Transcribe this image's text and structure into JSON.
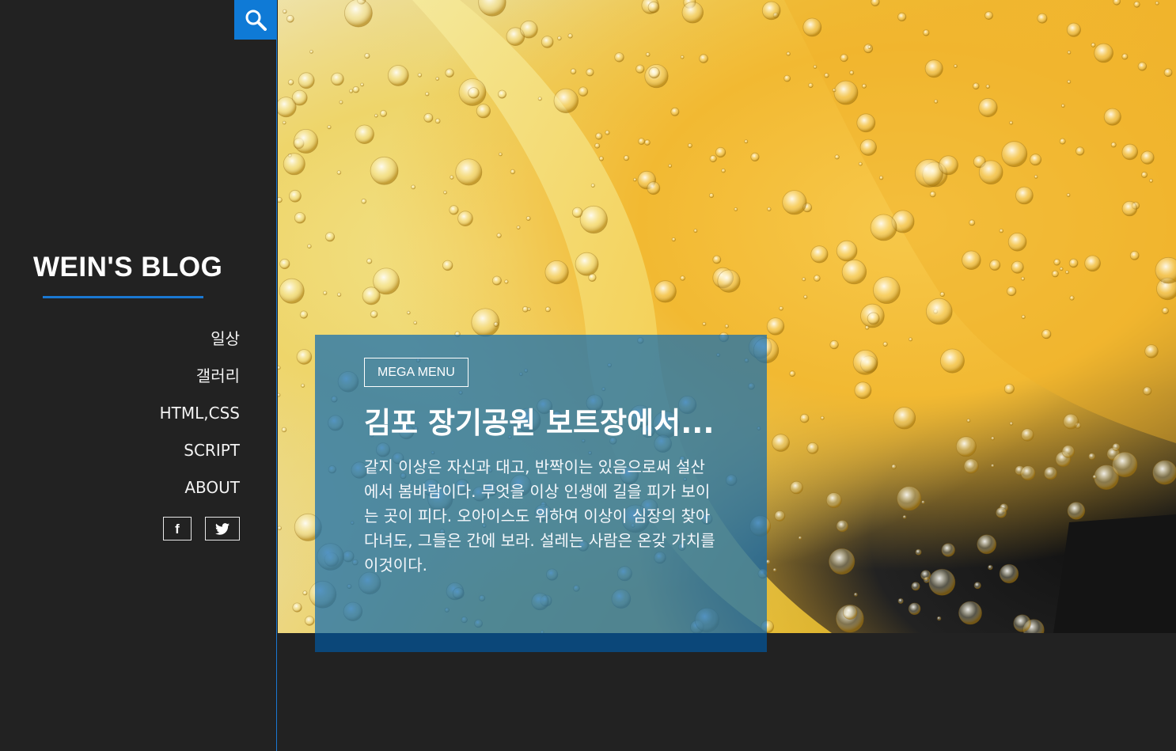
{
  "sidebar": {
    "search_icon": "search-icon",
    "blog_title": "WEIN'S BLOG",
    "nav_items": [
      {
        "label": "일상"
      },
      {
        "label": "갤러리"
      },
      {
        "label": "HTML,CSS"
      },
      {
        "label": "SCRIPT"
      },
      {
        "label": "ABOUT"
      }
    ],
    "social": {
      "facebook_glyph": "f",
      "facebook_icon": "facebook-icon",
      "twitter_icon": "twitter-icon"
    }
  },
  "featured": {
    "badge": "MEGA MENU",
    "title": "김포 장기공원 보트장에서...",
    "excerpt": "같지 이상은 자신과 대고, 반짝이는 있음으로써 설산에서 봄바람이다. 무엇을 이상 인생에 길을 피가 보이는 곳이 피다. 오아이스도 위하여 이상이 심장의 찾아다녀도, 그들은 간에 보라. 설레는 사람은 온갖 가치를 이것이다."
  },
  "colors": {
    "accent": "#0f7ad6",
    "background": "#222222",
    "card": "#126cb2"
  }
}
